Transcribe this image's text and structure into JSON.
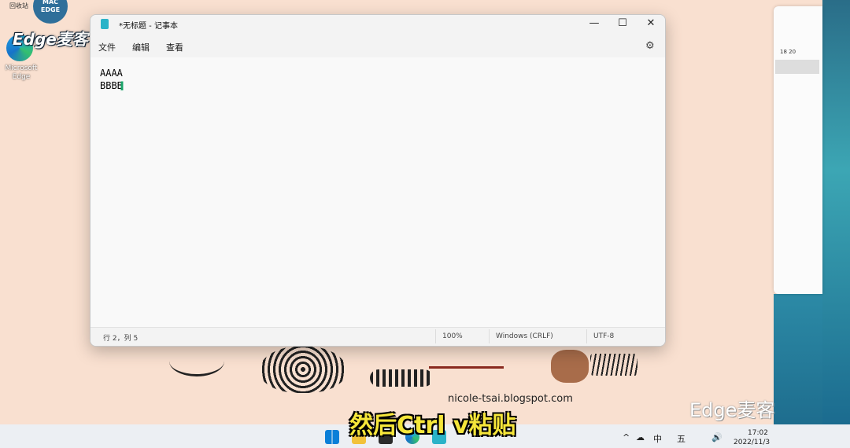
{
  "desktop": {
    "recycle_bin_label": "回收站",
    "logo_text": "MAC EDGE",
    "brand": "Edge麦客",
    "edge_icon_label": "Microsoft Edge"
  },
  "side_window": {
    "ruler_marks": "18        20"
  },
  "notepad": {
    "title": "*无标题 - 记事本",
    "controls": {
      "minimize": "—",
      "maximize": "☐",
      "close": "✕"
    },
    "menu": [
      "文件",
      "编辑",
      "查看"
    ],
    "content": "AAAA\nBBBB",
    "caret_glyph": "I",
    "status": {
      "position": "行 2，列 5",
      "zoom": "100%",
      "line_ending": "Windows (CRLF)",
      "encoding": "UTF-8"
    }
  },
  "blog_url": "nicole-tsai.blogspot.com",
  "watermark": "Edge麦客",
  "subtitle": "然后Ctrl v粘贴",
  "taskbar": {
    "tray": {
      "chevron": "^",
      "cloud": "☁",
      "ime_lang": "中",
      "ime_mode": "五",
      "volume": "🔊"
    },
    "time": "17:02",
    "date": "2022/11/3"
  },
  "colors": {
    "wallpaper": "#f9e0d0",
    "subtitle": "#f6e63a",
    "caret": "#1aa56a"
  },
  "icons": [
    "gear-icon",
    "notepad-icon",
    "windows-start-icon",
    "terminal-icon",
    "edge-icon",
    "folder-icon"
  ]
}
